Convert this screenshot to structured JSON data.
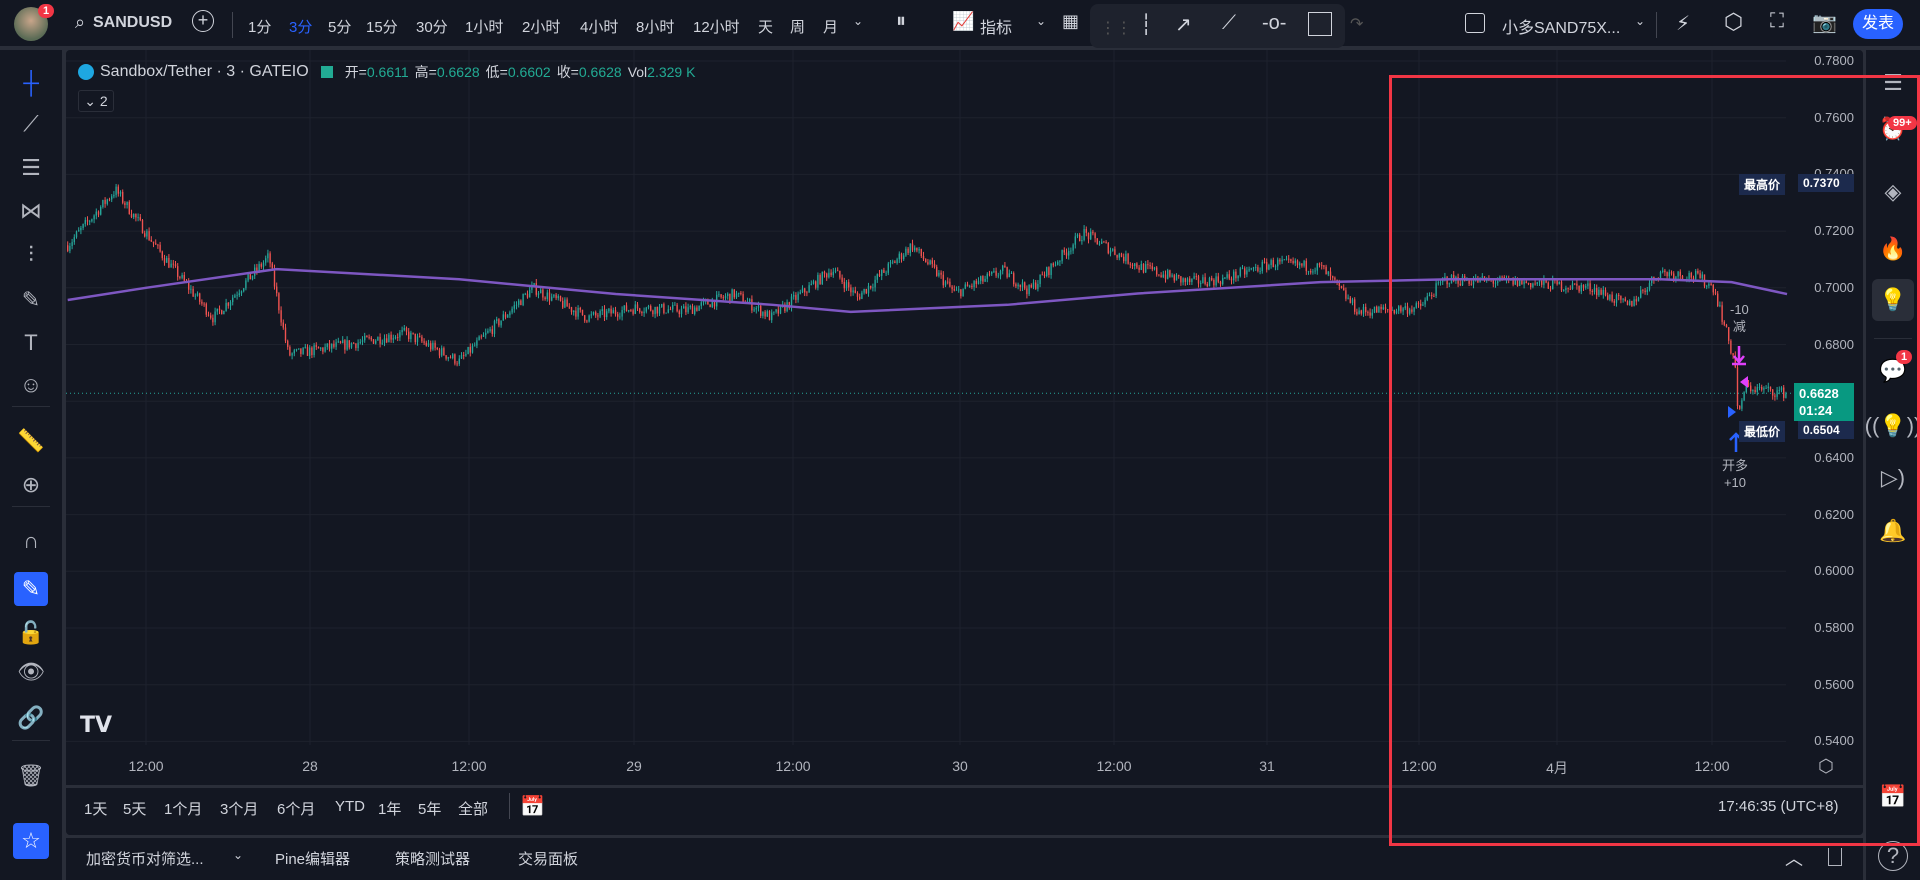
{
  "colors": {
    "background": "#131722",
    "up": "#26a69a",
    "down": "#ef5350",
    "ma": "#7e57c2",
    "accent": "#2962ff",
    "highlight_box": "#f23645"
  },
  "topbar": {
    "avatar_badge": "1",
    "symbol": "SANDUSD",
    "timeframes": [
      "1分",
      "3分",
      "5分",
      "15分",
      "30分",
      "1小时",
      "2小时",
      "4小时",
      "8小时",
      "12小时",
      "天",
      "周",
      "月"
    ],
    "active_timeframe": "3分",
    "indicators_label": "指标",
    "layout_name": "小多SAND75X...",
    "publish_label": "发表"
  },
  "legend": {
    "title": "Sandbox/Tether · 3 · GATEIO",
    "open_label": "开=",
    "open": "0.6611",
    "high_label": "高=",
    "high": "0.6628",
    "low_label": "低=",
    "low": "0.6602",
    "close_label": "收=",
    "close": "0.6628",
    "vol_label": "Vol",
    "vol": "2.329 K",
    "collapsed_count": "2"
  },
  "chart_data": {
    "type": "candlestick",
    "symbol": "SANDUSDT",
    "interval": "3m",
    "ylim": [
      0.53,
      0.785
    ],
    "y_ticks": [
      "0.7800",
      "0.7600",
      "0.7400",
      "0.7200",
      "0.7000",
      "0.6800",
      "0.6600",
      "0.6400",
      "0.6200",
      "0.6000",
      "0.5800",
      "0.5600",
      "0.5400"
    ],
    "x_ticks": [
      "12:00",
      "28",
      "12:00",
      "29",
      "12:00",
      "30",
      "12:00",
      "31",
      "12:00",
      "4月",
      "12:00"
    ],
    "price_path": [
      [
        "03-27 06:00",
        0.715
      ],
      [
        "03-27 09:40",
        0.7345
      ],
      [
        "03-27 13:00",
        0.713
      ],
      [
        "03-27 17:10",
        0.6893
      ],
      [
        "03-27 21:25",
        0.711
      ],
      [
        "03-27 22:55",
        0.6763
      ],
      [
        "03-28 04:00",
        0.6805
      ],
      [
        "03-28 07:50",
        0.684
      ],
      [
        "03-28 12:00",
        0.674
      ],
      [
        "03-28 17:40",
        0.7
      ],
      [
        "03-28 21:50",
        0.6895
      ],
      [
        "03-29 01:35",
        0.693
      ],
      [
        "03-29 05:25",
        0.692
      ],
      [
        "03-29 09:05",
        0.6978
      ],
      [
        "03-29 11:55",
        0.6895
      ],
      [
        "03-29 16:35",
        0.7066
      ],
      [
        "03-29 18:30",
        0.6966
      ],
      [
        "03-29 22:40",
        0.715
      ],
      [
        "03-30 02:00",
        0.698
      ],
      [
        "03-30 05:40",
        0.706
      ],
      [
        "03-30 07:40",
        0.699
      ],
      [
        "03-30 11:50",
        0.7194
      ],
      [
        "03-30 16:05",
        0.7075
      ],
      [
        "03-30 19:50",
        0.702
      ],
      [
        "03-30 22:35",
        0.703
      ],
      [
        "03-31 02:25",
        0.7088
      ],
      [
        "03-31 06:05",
        0.707
      ],
      [
        "03-31 08:55",
        0.6915
      ],
      [
        "03-31 13:35",
        0.693
      ],
      [
        "03-31 15:30",
        0.703
      ],
      [
        "03-31 21:05",
        0.702
      ],
      [
        "04-01 02:50",
        0.7
      ],
      [
        "04-01 05:35",
        0.6935
      ],
      [
        "04-01 08:00",
        0.7055
      ],
      [
        "04-01 10:50",
        0.704
      ],
      [
        "04-01 12:10",
        0.7
      ],
      [
        "04-01 13:50",
        0.672
      ],
      [
        "04-01 14:00",
        0.6526
      ],
      [
        "04-01 14:30",
        0.665
      ],
      [
        "04-01 15:55",
        0.664
      ],
      [
        "04-01 17:45",
        0.6628
      ]
    ],
    "moving_average": [
      [
        "03-27 06:00",
        0.6957
      ],
      [
        "03-27 12:00",
        0.7
      ],
      [
        "03-27 22:00",
        0.7066
      ],
      [
        "03-28 12:00",
        0.703
      ],
      [
        "03-29 00:00",
        0.6978
      ],
      [
        "03-29 12:00",
        0.694
      ],
      [
        "03-29 18:00",
        0.6915
      ],
      [
        "03-30 06:00",
        0.694
      ],
      [
        "03-30 16:00",
        0.698
      ],
      [
        "03-31 06:00",
        0.702
      ],
      [
        "03-31 16:00",
        0.703
      ],
      [
        "04-01 08:00",
        0.703
      ],
      [
        "04-01 13:30",
        0.702
      ],
      [
        "04-01 17:45",
        0.6978
      ]
    ],
    "high_marker": {
      "label": "最高价",
      "value": "0.7370"
    },
    "low_marker": {
      "label": "最低价",
      "value": "0.6504"
    },
    "last_price": {
      "value": "0.6628",
      "countdown": "01:24"
    },
    "trades": [
      {
        "label": "-10",
        "action": "减",
        "time": "04-01 13:40"
      },
      {
        "label": "+10",
        "action": "开多",
        "time": "04-01 14:00"
      }
    ]
  },
  "range_bar": {
    "ranges": [
      "1天",
      "5天",
      "1个月",
      "3个月",
      "6个月",
      "YTD",
      "1年",
      "5年",
      "全部"
    ],
    "clock": "17:46:35 (UTC+8)"
  },
  "bottom_tabs": [
    "加密货币对筛选...",
    "Pine编辑器",
    "策略测试器",
    "交易面板"
  ],
  "rightbar": {
    "alerts_badge": "99+",
    "chat_badge": "1"
  }
}
